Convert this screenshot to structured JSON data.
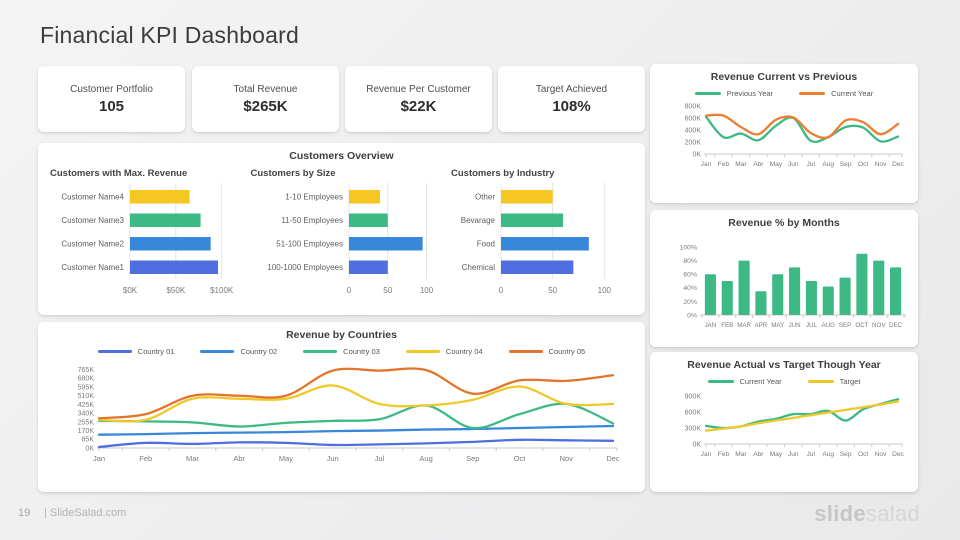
{
  "page": {
    "title": "Financial KPI Dashboard",
    "page_number": "19",
    "footer_text": "| SlideSalad.com",
    "logo": {
      "bold": "slide",
      "light": "salad"
    }
  },
  "colors": {
    "green": "#3CB984",
    "orange": "#ED7D31",
    "yellow": "#F6C623",
    "blue": "#3787DB",
    "royal_blue": "#4F6FE0",
    "target_yellow": "#EDC927",
    "card_bg": "#FFFFFF",
    "page_bg": "#EFEFF0"
  },
  "kpis": [
    {
      "label": "Customer Portfolio",
      "value": "105"
    },
    {
      "label": "Total Revenue",
      "value": "$265K"
    },
    {
      "label": "Revenue Per Customer",
      "value": "$22K"
    },
    {
      "label": "Target Achieved",
      "value": "108%"
    }
  ],
  "overview": {
    "title": "Customers Overview"
  },
  "chart_data": [
    {
      "id": "revenue-current-vs-previous",
      "type": "line",
      "title": "Revenue Current vs Previous",
      "x": [
        "Jan",
        "Feb",
        "Mar",
        "Abr",
        "May",
        "Jun",
        "Jul",
        "Aug",
        "Sep",
        "Oct",
        "Nov",
        "Dec"
      ],
      "series": [
        {
          "name": "Previous Year",
          "color": "#3CB984",
          "values": [
            620,
            280,
            340,
            230,
            470,
            600,
            220,
            280,
            450,
            440,
            210,
            290
          ]
        },
        {
          "name": "Current Year",
          "color": "#ED7D31",
          "values": [
            640,
            640,
            450,
            330,
            570,
            610,
            350,
            280,
            560,
            530,
            330,
            500
          ]
        }
      ],
      "ylim": [
        0,
        800
      ],
      "yticks": [
        0,
        200,
        400,
        600,
        800
      ],
      "ytick_labels": [
        "0K",
        "200K",
        "400K",
        "600K",
        "800K"
      ],
      "legend_position": "top",
      "grid": false
    },
    {
      "id": "customers-max-revenue",
      "type": "hbar",
      "title": "Customers with Max. Revenue",
      "categories": [
        "Customer Name4",
        "Customer Name3",
        "Customer Name2",
        "Customer Name1"
      ],
      "values": [
        65,
        77,
        88,
        96
      ],
      "bar_colors": [
        "#F6C623",
        "#3CB984",
        "#3787DB",
        "#4F6FE0"
      ],
      "xlim": [
        0,
        120
      ],
      "xticks": [
        0,
        50,
        100
      ],
      "xtick_labels": [
        "$0K",
        "$50K",
        "$100K"
      ],
      "grid": true
    },
    {
      "id": "customers-by-size",
      "type": "hbar",
      "title": "Customers by Size",
      "categories": [
        "1-10 Employees",
        "11-50 Employees",
        "51-100 Employees",
        "100-1000 Employees"
      ],
      "values": [
        40,
        50,
        95,
        50
      ],
      "bar_colors": [
        "#F6C623",
        "#3CB984",
        "#3787DB",
        "#4F6FE0"
      ],
      "xlim": [
        0,
        120
      ],
      "xticks": [
        0,
        50,
        100
      ],
      "xtick_labels": [
        "0",
        "50",
        "100"
      ],
      "grid": true
    },
    {
      "id": "customers-by-industry",
      "type": "hbar",
      "title": "Customers by Industry",
      "categories": [
        "Other",
        "Bevarage",
        "Food",
        "Chemical"
      ],
      "values": [
        50,
        60,
        85,
        70
      ],
      "bar_colors": [
        "#F6C623",
        "#3CB984",
        "#3787DB",
        "#4F6FE0"
      ],
      "xlim": [
        0,
        120
      ],
      "xticks": [
        0,
        50,
        100
      ],
      "xtick_labels": [
        "0",
        "50",
        "100"
      ],
      "grid": true
    },
    {
      "id": "revenue-by-countries",
      "type": "line",
      "title": "Revenue by Countries",
      "x": [
        "Jan",
        "Feb",
        "Mar",
        "Abr",
        "May",
        "Jun",
        "Jul",
        "Aug",
        "Sep",
        "Oct",
        "Nov",
        "Dec"
      ],
      "series": [
        {
          "name": "Country 01",
          "color": "#4F6FE0",
          "values": [
            10,
            50,
            40,
            55,
            50,
            30,
            35,
            45,
            60,
            80,
            75,
            70
          ]
        },
        {
          "name": "Country 02",
          "color": "#3787DB",
          "values": [
            130,
            135,
            145,
            150,
            155,
            165,
            170,
            180,
            185,
            195,
            205,
            215
          ]
        },
        {
          "name": "Country 03",
          "color": "#3CB984",
          "values": [
            265,
            260,
            250,
            210,
            245,
            265,
            280,
            415,
            195,
            330,
            430,
            240
          ]
        },
        {
          "name": "Country 04",
          "color": "#F0C929",
          "values": [
            275,
            275,
            480,
            480,
            480,
            610,
            430,
            415,
            470,
            600,
            430,
            430
          ]
        },
        {
          "name": "Country 05",
          "color": "#E2752E",
          "values": [
            290,
            330,
            510,
            510,
            510,
            755,
            755,
            760,
            530,
            660,
            655,
            710
          ]
        }
      ],
      "ylim": [
        0,
        800
      ],
      "yticks": [
        0,
        85,
        170,
        255,
        340,
        425,
        510,
        595,
        680,
        765
      ],
      "ytick_labels": [
        "0K",
        "85K",
        "170K",
        "255K",
        "340K",
        "425K",
        "510K",
        "595K",
        "680K",
        "765K"
      ],
      "legend_position": "top",
      "grid": false
    },
    {
      "id": "revenue-pct-by-months",
      "type": "bar",
      "title": "Revenue % by Months",
      "categories": [
        "JAN",
        "FEB",
        "MAR",
        "APR",
        "MAY",
        "JUN",
        "JUL",
        "AUG",
        "SEP",
        "OCT",
        "NOV",
        "DEC"
      ],
      "values": [
        60,
        50,
        80,
        35,
        60,
        70,
        50,
        42,
        55,
        90,
        80,
        70
      ],
      "bar_color": "#3CB984",
      "ylim": [
        0,
        100
      ],
      "yticks": [
        0,
        20,
        40,
        60,
        80,
        100
      ],
      "ytick_labels": [
        "0%",
        "20%",
        "40%",
        "60%",
        "80%",
        "100%"
      ],
      "grid": false
    },
    {
      "id": "revenue-actual-vs-target",
      "type": "line",
      "title": "Revenue Actual vs Target Though Year",
      "x": [
        "Jan",
        "Feb",
        "Mar",
        "Abr",
        "May",
        "Jun",
        "Jul",
        "Aug",
        "Sep",
        "Oct",
        "Nov",
        "Dec"
      ],
      "series": [
        {
          "name": "Current Year",
          "color": "#3CB984",
          "values": [
            340,
            300,
            330,
            420,
            470,
            560,
            560,
            620,
            440,
            650,
            750,
            840
          ]
        },
        {
          "name": "Target",
          "color": "#EDC927",
          "values": [
            250,
            290,
            330,
            390,
            440,
            490,
            540,
            590,
            640,
            690,
            740,
            800
          ]
        }
      ],
      "ylim": [
        0,
        900
      ],
      "yticks": [
        0,
        300,
        600,
        900
      ],
      "ytick_labels": [
        "0K",
        "300K",
        "600K",
        "900K"
      ],
      "legend_position": "top",
      "grid": false
    }
  ]
}
